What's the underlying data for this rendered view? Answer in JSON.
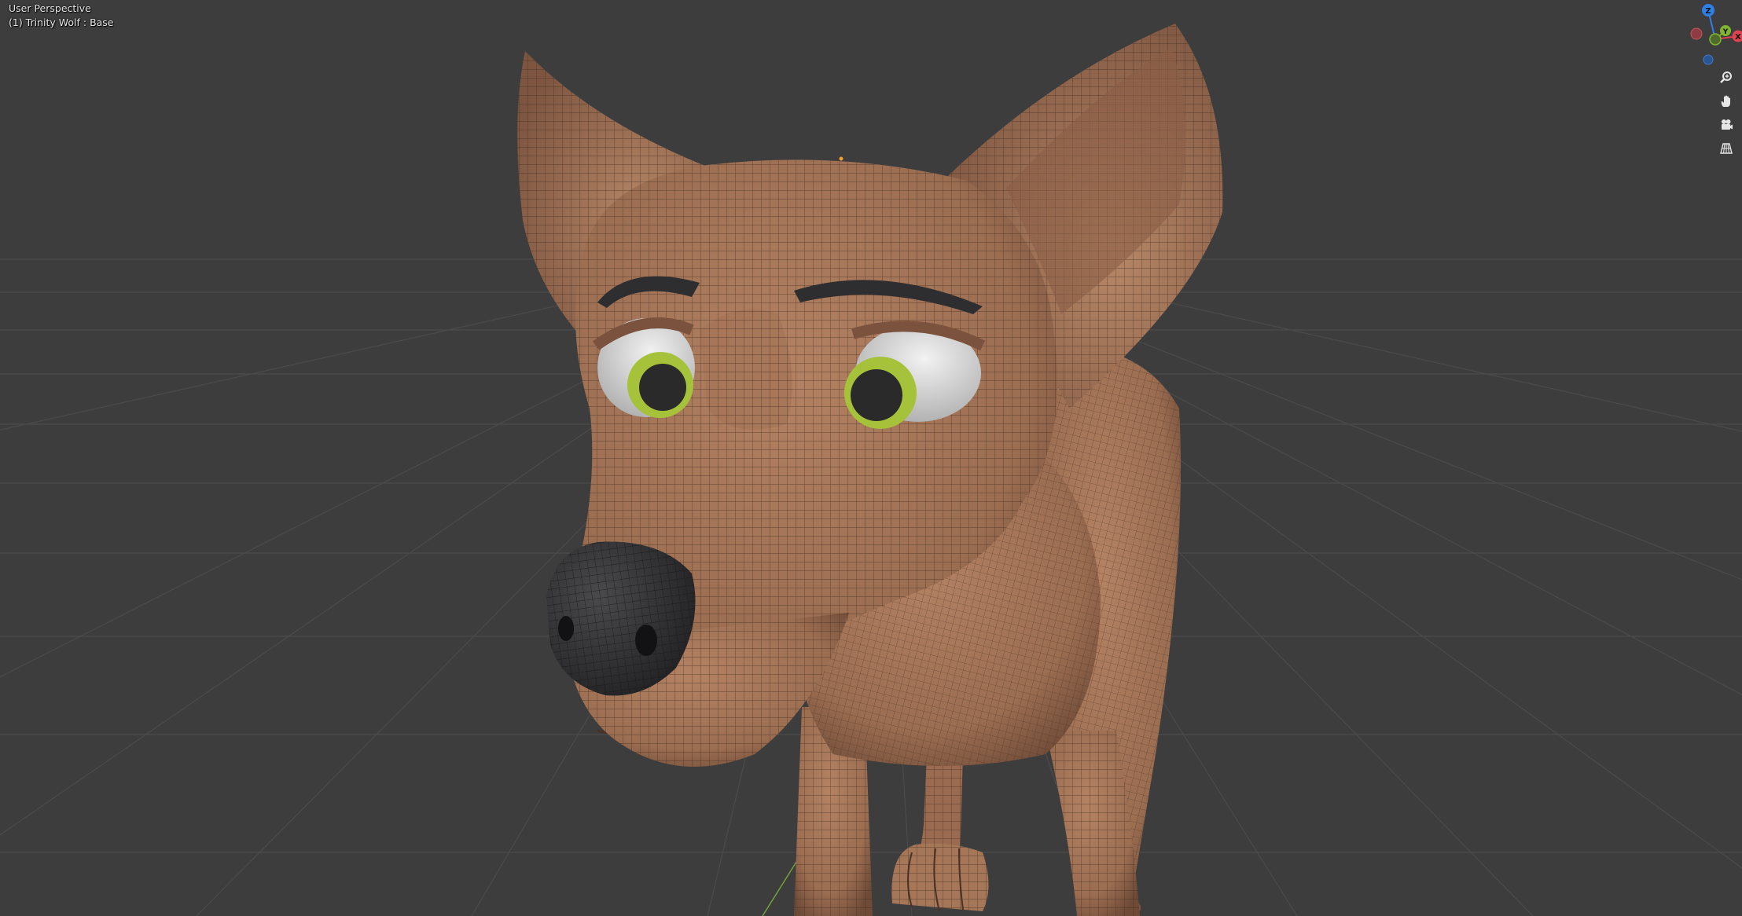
{
  "viewport": {
    "view_title": "User Perspective",
    "object_info": "(1) Trinity Wolf : Base"
  },
  "gizmo": {
    "axes": [
      {
        "name": "Z",
        "color": "#2f7fe8"
      },
      {
        "name": "Y",
        "color": "#82b530"
      },
      {
        "name": "X",
        "color": "#e0434f"
      }
    ]
  },
  "nav_buttons": [
    "zoom-icon",
    "hand-pan-icon",
    "camera-icon",
    "grid-perspective-icon"
  ],
  "colors": {
    "background": "#3d3d3d",
    "grid": "#4a4a4a",
    "fur": "#a27355",
    "wire": "#3e2a1f",
    "nose": "#2b2b2d",
    "iris": "#a6c23a",
    "eye_white": "#d9d9d9"
  }
}
